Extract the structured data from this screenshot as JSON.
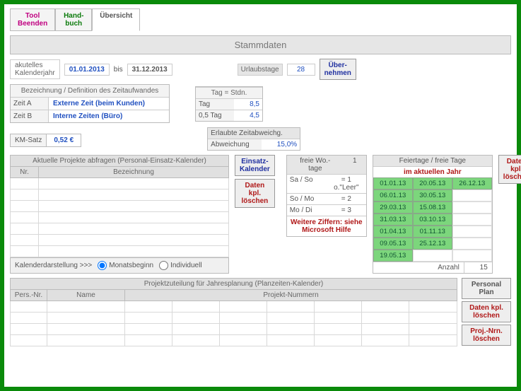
{
  "tabs": {
    "tool": "Tool\nBeenden",
    "hand": "Hand-\nbuch",
    "overview": "Übersicht"
  },
  "section_title": "Stammdaten",
  "year": {
    "label": "akutelles\nKalenderjahr",
    "from": "01.01.2013",
    "to_label": "bis",
    "to": "31.12.2013"
  },
  "urlaub": {
    "label": "Urlaubstage",
    "value": "28",
    "btn": "Über-\nnehmen"
  },
  "defs": {
    "header": "Bezeichnung / Definition des Zeitaufwandes",
    "a_label": "Zeit A",
    "a_value": "Externe Zeit (beim Kunden)",
    "b_label": "Zeit B",
    "b_value": "Interne Zeiten (Büro)"
  },
  "tag": {
    "header": "Tag = Stdn.",
    "full_label": "Tag",
    "full": "8,5",
    "half_label": "0,5 Tag",
    "half": "4,5"
  },
  "km": {
    "label": "KM-Satz",
    "value": "0,52 €"
  },
  "abw": {
    "header": "Erlaubte Zeitabweichg.",
    "label": "Abweichung",
    "value": "15,0%"
  },
  "projects": {
    "header": "Aktuelle Projekte abfragen (Personal-Einsatz-Kalender)",
    "col_nr": "Nr.",
    "col_bez": "Bezeichnung",
    "footer_label": "Kalenderdarstellung >>>",
    "radio_month": "Monatsbeginn",
    "radio_ind": "Individuell"
  },
  "btns": {
    "einsatz": "Einsatz-\nKalender",
    "delete": "Daten kpl.\nlöschen",
    "personal": "Personal\nPlan",
    "projnr": "Proj.-Nrn.\nlöschen"
  },
  "free": {
    "header": "freie Wo.-\ntage",
    "count": "1",
    "r1a": "Sa / So",
    "r1b": "= 1 o.\"Leer\"",
    "r2a": "So / Mo",
    "r2b": "= 2",
    "r3a": "Mo / Di",
    "r3b": "= 3",
    "note": "Weitere Ziffern: siehe\nMicrosoft Hilfe"
  },
  "holidays": {
    "header": "Feiertage / freie Tage",
    "sub": "im aktuellen Jahr",
    "grid": [
      [
        "01.01.13",
        "20.05.13",
        "26.12.13"
      ],
      [
        "06.01.13",
        "30.05.13",
        ""
      ],
      [
        "29.03.13",
        "15.08.13",
        ""
      ],
      [
        "31.03.13",
        "03.10.13",
        ""
      ],
      [
        "01.04.13",
        "01.11.13",
        ""
      ],
      [
        "09.05.13",
        "25.12.13",
        ""
      ],
      [
        "19.05.13",
        "",
        ""
      ]
    ],
    "footer_label": "Anzahl",
    "footer_value": "15"
  },
  "assign": {
    "header": "Projektzuteilung für Jahresplanung (Planzeiten-Kalender)",
    "col_persnr": "Pers.-Nr.",
    "col_name": "Name",
    "col_proj": "Projekt-Nummern"
  }
}
